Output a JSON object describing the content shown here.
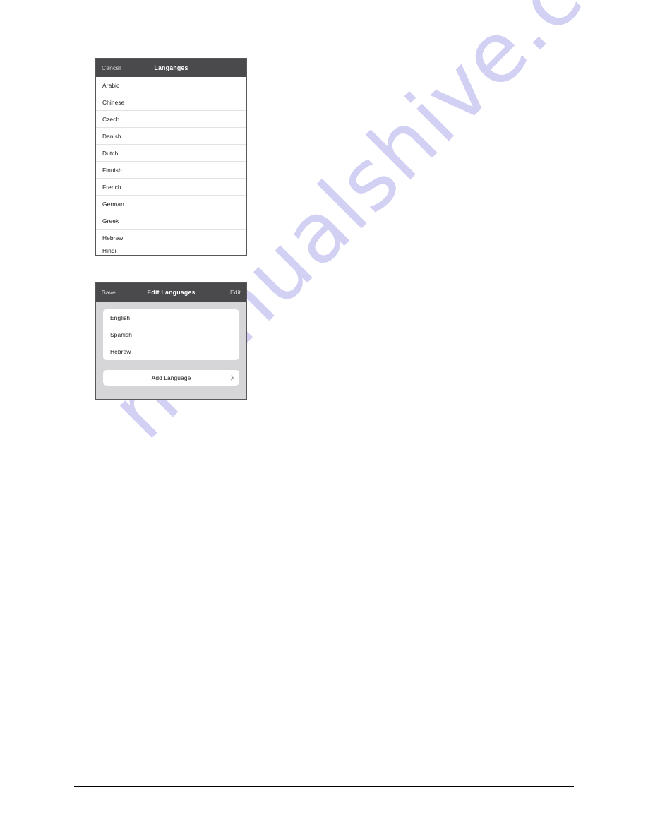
{
  "watermark": {
    "text": "manualshive.com",
    "color": "#cfcdf2"
  },
  "panel_languages": {
    "header": {
      "cancel_label": "Cancel",
      "title": "Langanges"
    },
    "items": [
      {
        "label": "Arabic"
      },
      {
        "label": "Chinese"
      },
      {
        "label": "Czech"
      },
      {
        "label": "Danish"
      },
      {
        "label": "Dutch"
      },
      {
        "label": "Finnish"
      },
      {
        "label": "French"
      },
      {
        "label": "German"
      },
      {
        "label": "Greek"
      },
      {
        "label": "Hebrew"
      },
      {
        "label": "Hindi"
      }
    ]
  },
  "panel_edit": {
    "header": {
      "save_label": "Save",
      "title": "Edit Languages",
      "edit_label": "Edit"
    },
    "selected": [
      {
        "label": "English"
      },
      {
        "label": "Spanish"
      },
      {
        "label": "Hebrew"
      }
    ],
    "add_button": {
      "label": "Add Language"
    }
  }
}
